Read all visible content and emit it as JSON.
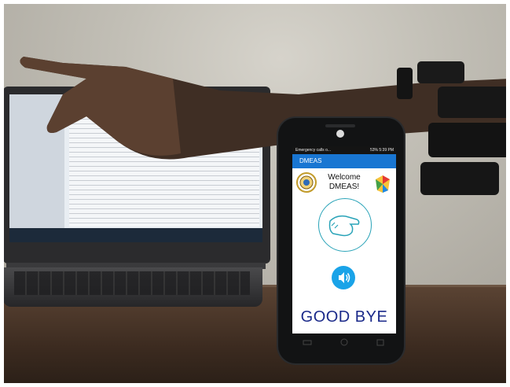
{
  "phone": {
    "status_left": "Emergency calls o...",
    "status_right": "53% 5:39 PM",
    "app_title": "DMEAS",
    "welcome_line1": "Welcome",
    "welcome_line2": "DMEAS!",
    "result_text": "GOOD BYE",
    "speaker_icon": "speaker-icon",
    "gesture_icon": "hand-gesture-icon"
  },
  "colors": {
    "app_bar": "#1976d2",
    "speaker_button": "#1aa3e8",
    "result_text": "#1b2a8a",
    "gesture_ring": "#29a3b8"
  }
}
